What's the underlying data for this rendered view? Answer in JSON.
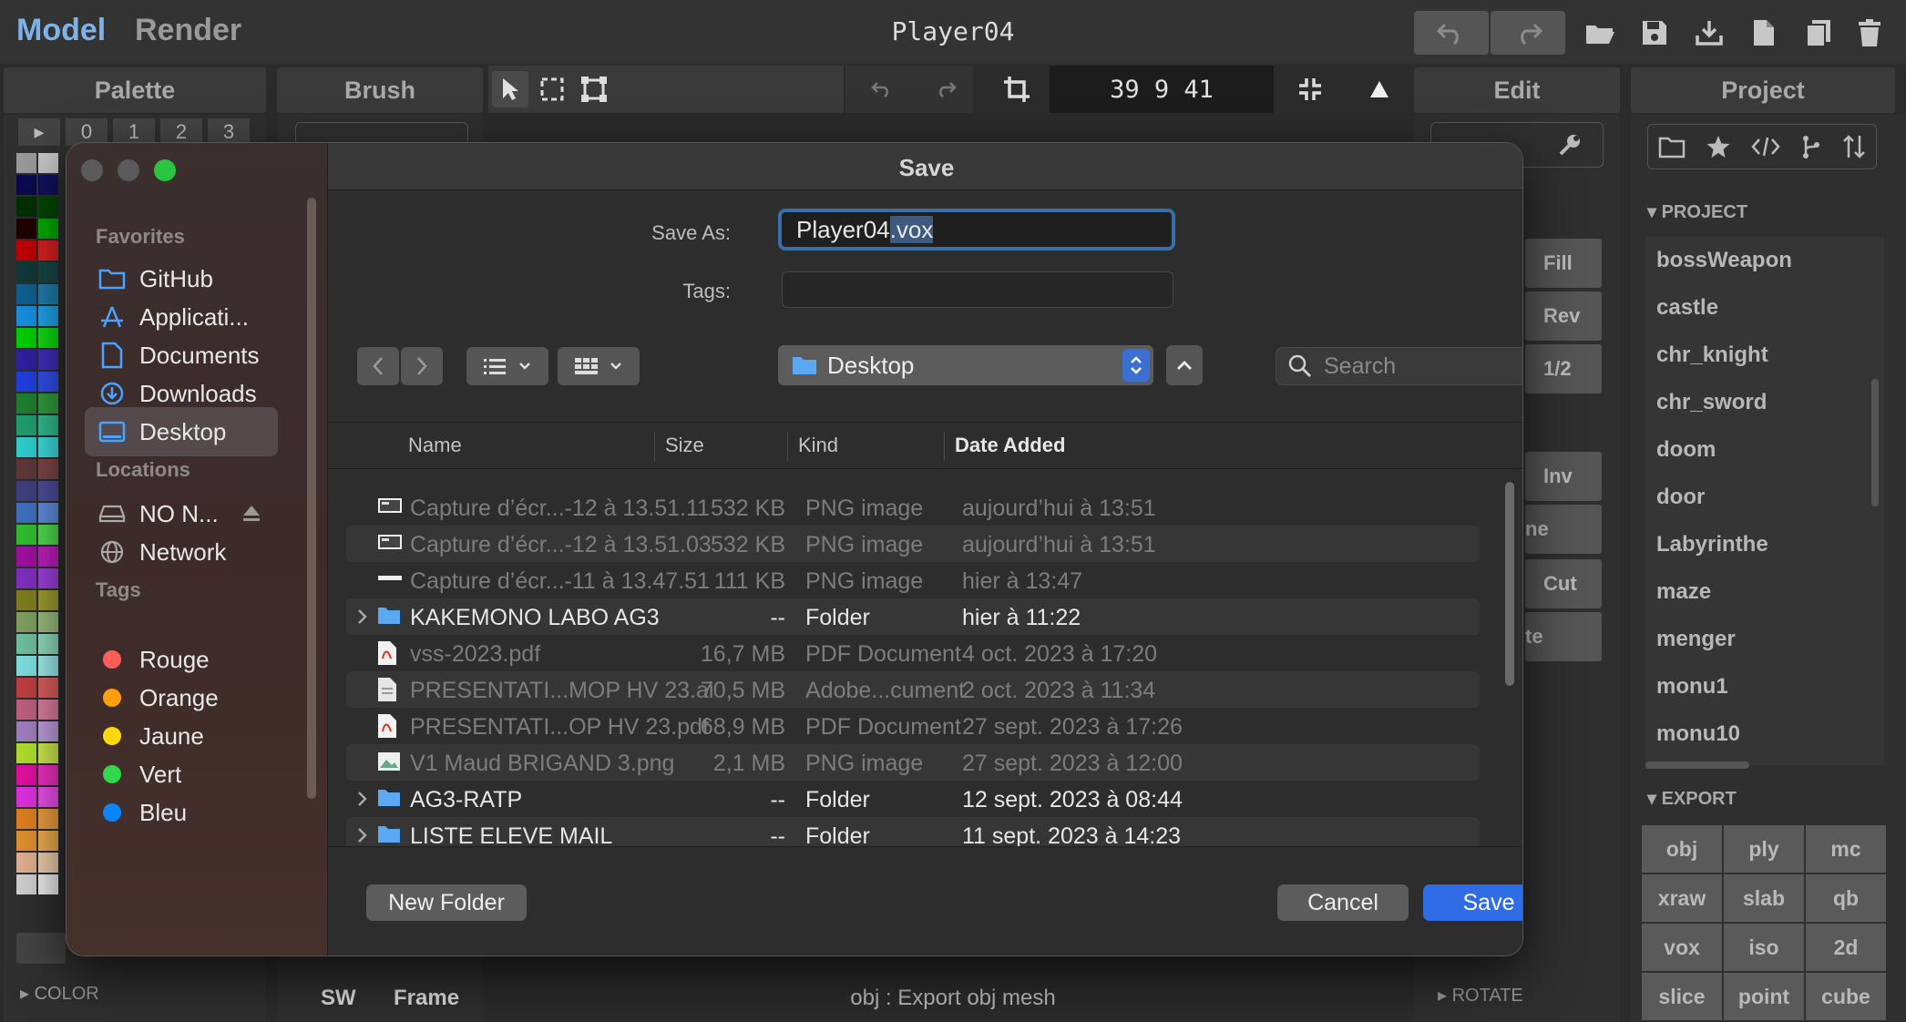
{
  "app": {
    "modes": [
      "Model",
      "Render"
    ],
    "document_title": "Player04",
    "coords": "39  9  41",
    "status": "obj : Export obj mesh"
  },
  "panels": {
    "palette": "Palette",
    "brush": "Brush",
    "edit": "Edit",
    "project": "Project"
  },
  "palette_tabs": [
    "0",
    "1",
    "2",
    "3"
  ],
  "palette_footer": "▸ COLOR",
  "brush_footer": {
    "sw": "SW",
    "frame": "Frame"
  },
  "edit_buttons": [
    "Fill",
    "Rev",
    "1/2",
    "Inv",
    "ne",
    "Cut",
    "te"
  ],
  "edit_footer": "▸ ROTATE",
  "project": {
    "section": "▾ PROJECT",
    "items": [
      "bossWeapon",
      "castle",
      "chr_knight",
      "chr_sword",
      "doom",
      "door",
      "Labyrinthe",
      "maze",
      "menger",
      "monu1",
      "monu10"
    ]
  },
  "export": {
    "section": "▾ EXPORT",
    "formats": [
      "obj",
      "ply",
      "mc",
      "xraw",
      "slab",
      "qb",
      "vox",
      "iso",
      "2d",
      "slice",
      "point",
      "cube"
    ]
  },
  "dialog": {
    "title": "Save",
    "save_as_label": "Save As:",
    "save_as_base": "Player04",
    "save_as_ext": ".vox",
    "tags_label": "Tags:",
    "location": "Desktop",
    "search_placeholder": "Search",
    "columns": {
      "name": "Name",
      "size": "Size",
      "kind": "Kind",
      "date": "Date Added"
    },
    "files": [
      {
        "name": "Capture d’écr...-12 à 13.51.11",
        "size": "532 KB",
        "kind": "PNG image",
        "date": "aujourd’hui à 13:51",
        "type": "screenshot"
      },
      {
        "name": "Capture d’écr...-12 à 13.51.03",
        "size": "532 KB",
        "kind": "PNG image",
        "date": "aujourd’hui à 13:51",
        "type": "screenshot"
      },
      {
        "name": "Capture d’écr...-11 à 13.47.51",
        "size": "111 KB",
        "kind": "PNG image",
        "date": "hier à 13:47",
        "type": "screenshot-thin"
      },
      {
        "name": "KAKEMONO LABO AG3",
        "size": "--",
        "kind": "Folder",
        "date": "hier à 11:22",
        "type": "folder"
      },
      {
        "name": "vss-2023.pdf",
        "size": "16,7 MB",
        "kind": "PDF Document",
        "date": "4 oct. 2023 à 17:20",
        "type": "pdf"
      },
      {
        "name": "PRESENTATI...MOP HV 23.ai",
        "size": "70,5 MB",
        "kind": "Adobe...cument",
        "date": "2 oct. 2023 à 11:34",
        "type": "doc"
      },
      {
        "name": "PRESENTATI...OP HV 23.pdf",
        "size": "68,9 MB",
        "kind": "PDF Document",
        "date": "27 sept. 2023 à 17:26",
        "type": "pdf"
      },
      {
        "name": "V1 Maud BRIGAND 3.png",
        "size": "2,1 MB",
        "kind": "PNG image",
        "date": "27 sept. 2023 à 12:00",
        "type": "image"
      },
      {
        "name": "AG3-RATP",
        "size": "--",
        "kind": "Folder",
        "date": "12 sept. 2023 à 08:44",
        "type": "folder"
      },
      {
        "name": "LISTE ELEVE MAIL",
        "size": "--",
        "kind": "Folder",
        "date": "11 sept. 2023 à 14:23",
        "type": "folder"
      }
    ],
    "buttons": {
      "new_folder": "New Folder",
      "cancel": "Cancel",
      "save": "Save"
    },
    "sidebar": {
      "favorites_head": "Favorites",
      "favorites": [
        "GitHub",
        "Applicati...",
        "Documents",
        "Downloads",
        "Desktop"
      ],
      "locations_head": "Locations",
      "locations": [
        "NO N...",
        "Network"
      ],
      "tags_head": "Tags",
      "tags": [
        {
          "label": "Rouge",
          "color": "#ff5f57"
        },
        {
          "label": "Orange",
          "color": "#ff9f0a"
        },
        {
          "label": "Jaune",
          "color": "#ffd60a"
        },
        {
          "label": "Vert",
          "color": "#32d74b"
        },
        {
          "label": "Bleu",
          "color": "#0a84ff"
        }
      ]
    }
  },
  "colors": {
    "accent": "#2f6ce5",
    "model_tab": "#7db3e8",
    "focus_ring": "#3b6fa8"
  }
}
